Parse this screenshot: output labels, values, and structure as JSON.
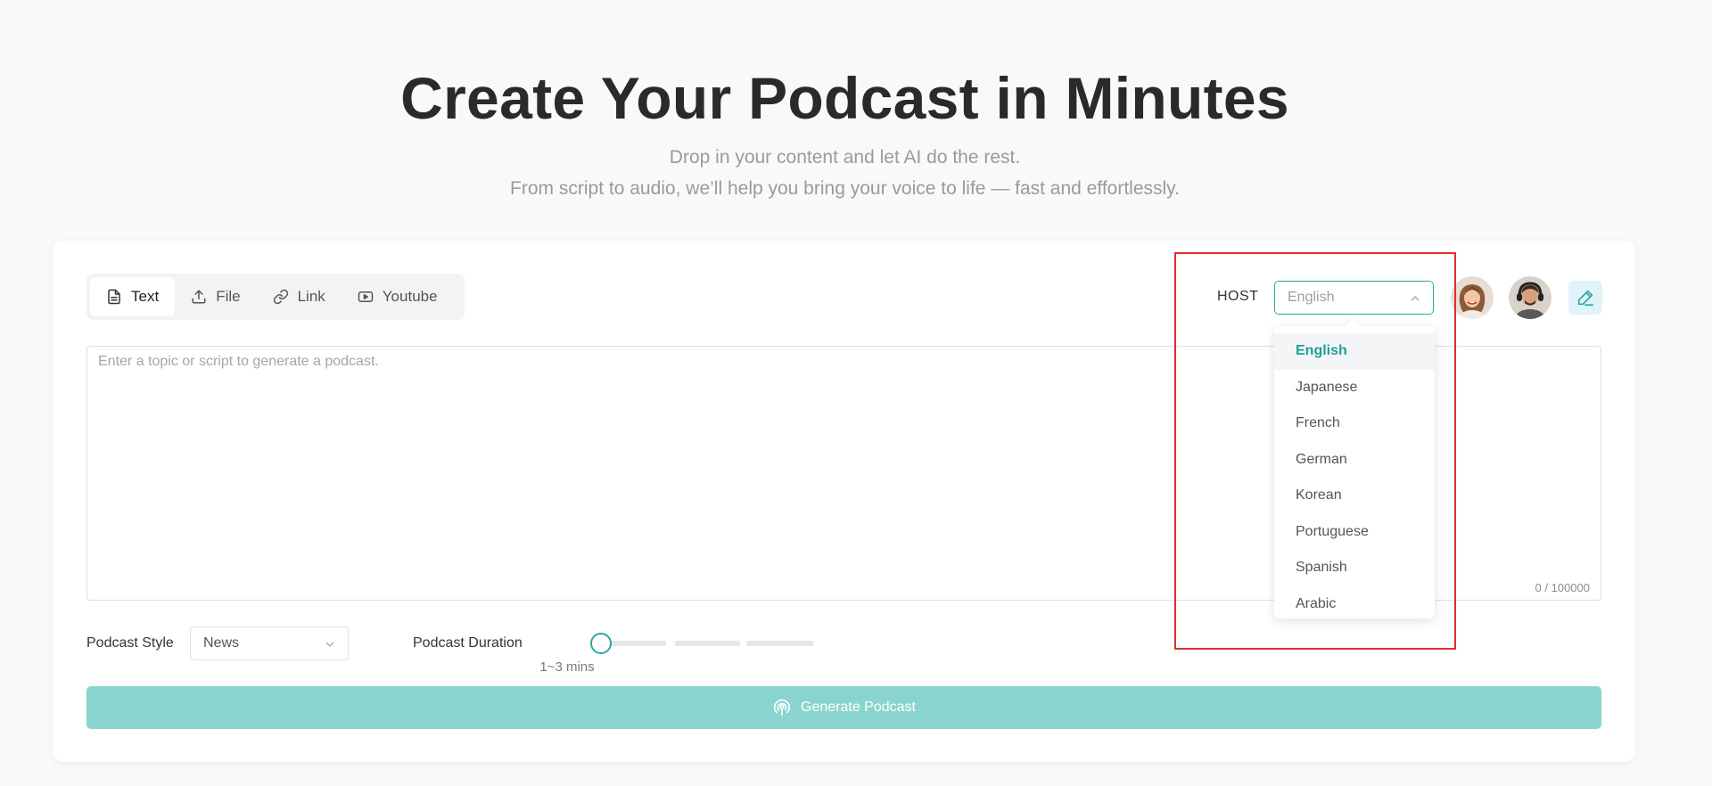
{
  "hero": {
    "title": "Create Your Podcast in Minutes",
    "subtitle_line1": "Drop in your content and let AI do the rest.",
    "subtitle_line2": "From script to audio, we’ll help you bring your voice to life — fast and effortlessly."
  },
  "tabs": [
    {
      "label": "Text",
      "icon": "document-icon",
      "active": true
    },
    {
      "label": "File",
      "icon": "upload-icon",
      "active": false
    },
    {
      "label": "Link",
      "icon": "link-icon",
      "active": false
    },
    {
      "label": "Youtube",
      "icon": "play-icon",
      "active": false
    }
  ],
  "host": {
    "label": "HOST",
    "placeholder": "English",
    "options": [
      "English",
      "Japanese",
      "French",
      "German",
      "Korean",
      "Portuguese",
      "Spanish",
      "Arabic"
    ],
    "selected": "English"
  },
  "input": {
    "placeholder": "Enter a topic or script to generate a podcast.",
    "counter": "0 / 100000"
  },
  "style": {
    "label": "Podcast Style",
    "value": "News"
  },
  "duration": {
    "label": "Podcast Duration",
    "value": "1~3 mins",
    "level": 0
  },
  "generate_label": "Generate Podcast",
  "colors": {
    "accent": "#2aa8a0",
    "button": "#8ad4cf",
    "annotation": "#e02d2d"
  }
}
